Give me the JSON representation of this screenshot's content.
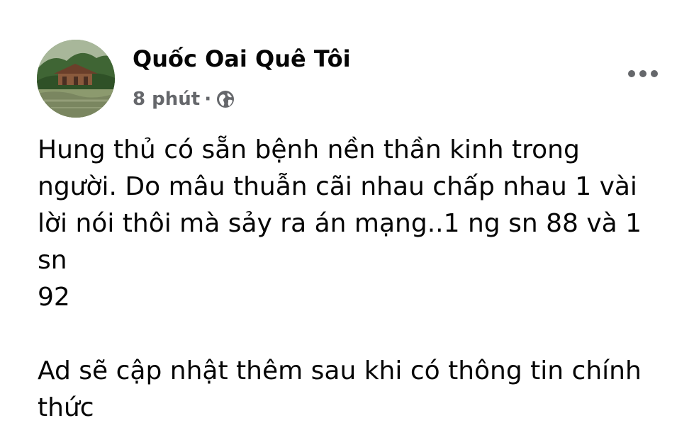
{
  "post": {
    "author": "Quốc Oai Quê Tôi",
    "timestamp": "8 phút",
    "separator": "·",
    "privacy_icon": "globe-icon",
    "more_icon": "more-options-icon",
    "paragraphs": [
      "Hung thủ có sẵn bệnh nền thần kinh trong\nngười. Do mâu thuẫn cãi nhau chấp nhau 1 vài\nlời nói thôi mà sảy ra án mạng..1 ng sn 88 và 1 sn\n92",
      "Ad sẽ cập nhật thêm sau khi có thông tin chính\nthức"
    ]
  },
  "colors": {
    "text_primary": "#050505",
    "text_secondary": "#65676b",
    "background": "#ffffff"
  }
}
